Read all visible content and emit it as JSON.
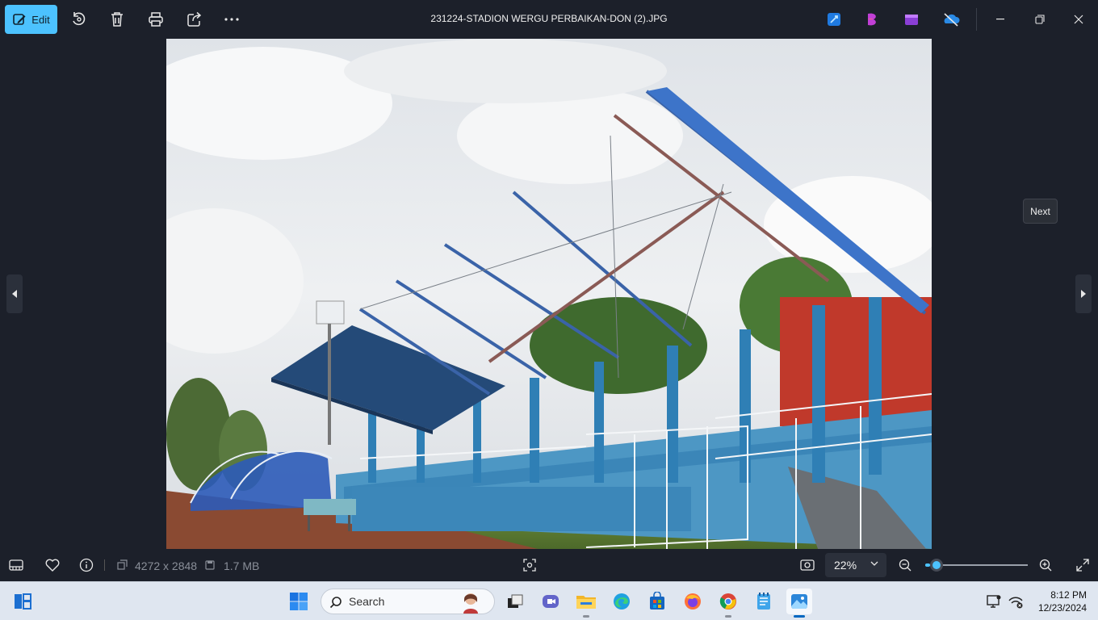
{
  "toolbar": {
    "edit_label": "Edit",
    "file_title": "231224-STADION WERGU PERBAIKAN-DON (2).JPG",
    "tools": [
      "rotate-icon",
      "delete-icon",
      "print-icon",
      "share-icon",
      "more-icon"
    ],
    "apps": [
      "designer-icon",
      "clipchamp-icon",
      "video-editor-icon",
      "onedrive-icon"
    ]
  },
  "nav": {
    "tooltip": "Next"
  },
  "status": {
    "dimensions": "4272 x 2848",
    "file_size": "1.7 MB",
    "zoom": "22%",
    "zoom_level": 0.05
  },
  "taskbar": {
    "search_placeholder": "Search",
    "time": "8:12 PM",
    "date": "12/23/2024"
  },
  "colors": {
    "accent": "#4cc2ff",
    "background": "#1c202a",
    "taskbar": "#dfe6f0"
  }
}
